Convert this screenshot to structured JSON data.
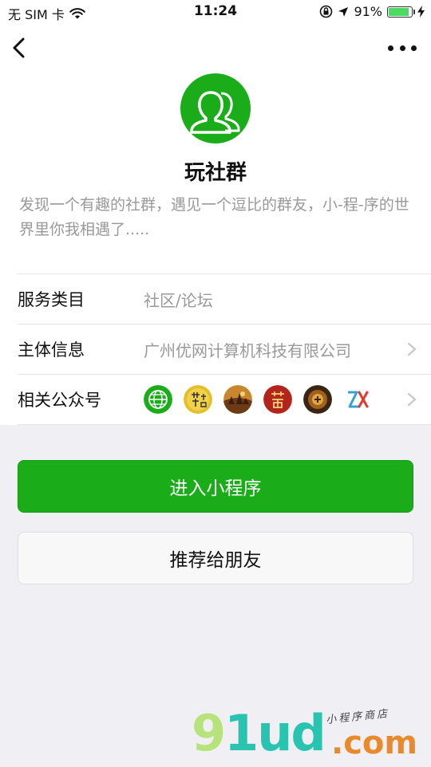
{
  "status_bar": {
    "carrier": "无 SIM 卡",
    "time": "11:24",
    "battery": "91%",
    "battery_level": 0.91
  },
  "app": {
    "name": "玩社群",
    "description": "发现一个有趣的社群，遇见一个逗比的群友，小-程-序的世界里你我相遇了....."
  },
  "info": {
    "service_category": {
      "label": "服务类目",
      "value": "社区/论坛"
    },
    "entity_info": {
      "label": "主体信息",
      "value": "广州优网计算机科技有限公司"
    },
    "related_accounts": {
      "label": "相关公众号",
      "accounts": [
        "globe-green",
        "tea-gold",
        "landscape-sunset",
        "red-seal",
        "dark-gold",
        "zx-logo"
      ]
    }
  },
  "buttons": {
    "enter": "进入小程序",
    "share": "推荐给朋友"
  },
  "watermark": {
    "brand_a": "9",
    "brand_b": "1ud",
    "suffix": ".com",
    "tagline": "小程序商店"
  },
  "colors": {
    "primary": "#1aad19",
    "background": "#efeff4",
    "secondary_text": "#999999",
    "watermark_teal": "#29c4b0",
    "watermark_orange": "#e88a2b"
  }
}
